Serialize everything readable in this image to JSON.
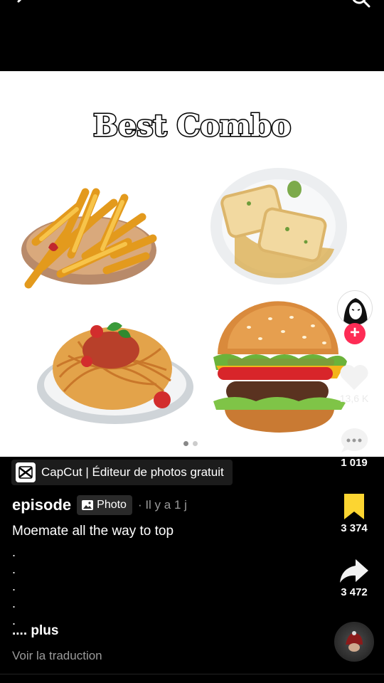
{
  "top_bar": {
    "back_icon": "chevron-left-icon",
    "search_icon": "search-icon"
  },
  "post": {
    "title": "Best Combo",
    "images": [
      "fries",
      "ravioli",
      "spaghetti",
      "burger"
    ],
    "carousel": {
      "count": 2,
      "active": 1
    }
  },
  "rail": {
    "like_count": "13,6 K",
    "comment_count": "1 019",
    "bookmark_count": "3 374",
    "share_count": "3 472",
    "colors": {
      "accent": "#fe2c55",
      "bookmark": "#fcd531"
    }
  },
  "capcut": {
    "label": "CapCut | Éditeur de photos gratuit"
  },
  "author": {
    "name": "episode",
    "badge": "Photo",
    "time": "· Il y a 1 j"
  },
  "caption": {
    "text": "Moemate all the way to top",
    "dots": [
      ".",
      ".",
      ".",
      ".",
      "."
    ],
    "more": ".... plus",
    "translate": "Voir la traduction"
  }
}
